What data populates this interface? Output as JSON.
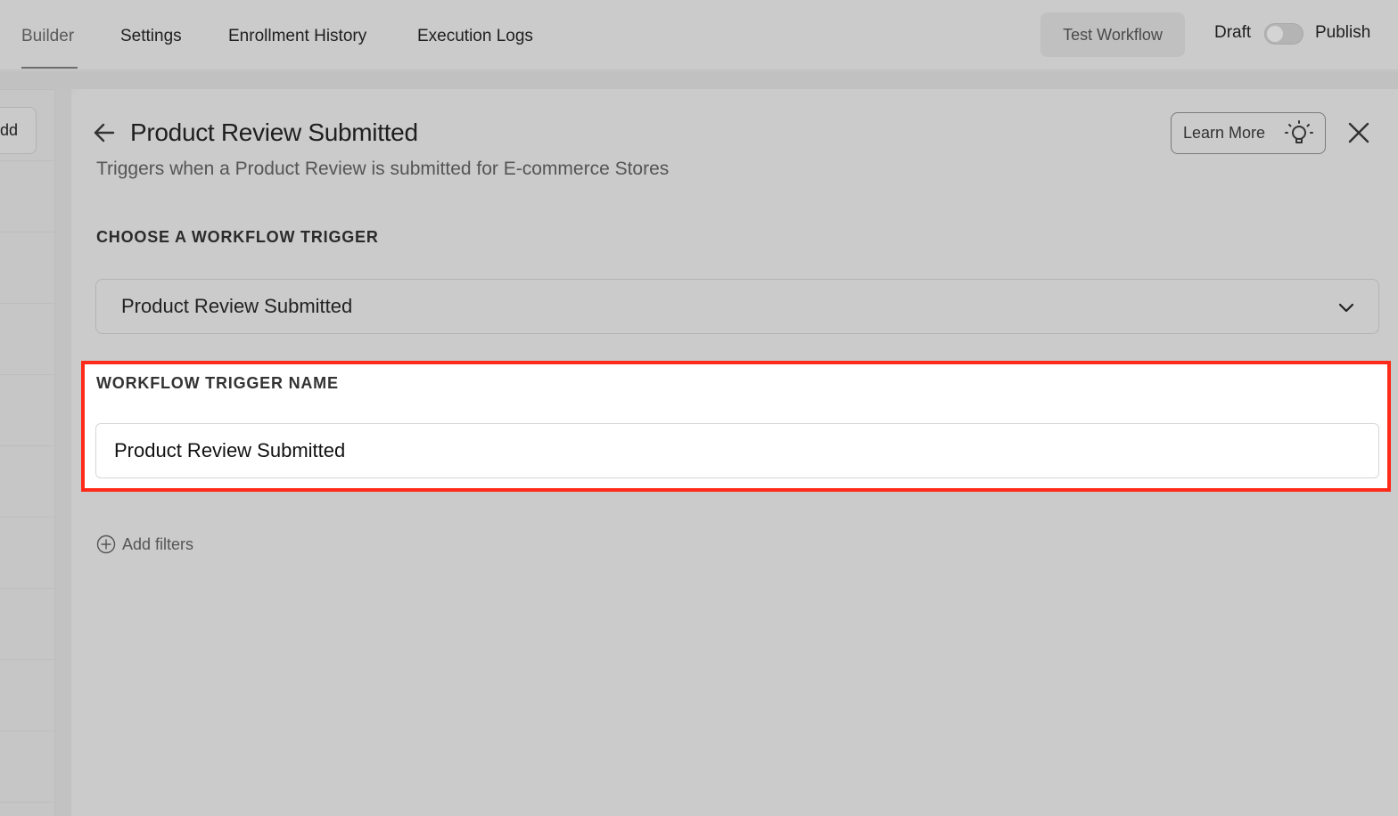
{
  "nav": {
    "tabs": [
      {
        "label": "Builder",
        "active": true
      },
      {
        "label": "Settings",
        "active": false
      },
      {
        "label": "Enrollment History",
        "active": false
      },
      {
        "label": "Execution Logs",
        "active": false
      }
    ],
    "test_workflow_label": "Test Workflow",
    "draft_label": "Draft",
    "publish_label": "Publish",
    "publish_toggle_on": false
  },
  "sidebar": {
    "add_button_label": "Add"
  },
  "panel": {
    "title": "Product Review Submitted",
    "subtitle": "Triggers when a Product Review is submitted for E-commerce Stores",
    "learn_more_label": "Learn More",
    "trigger_section_label": "CHOOSE A WORKFLOW TRIGGER",
    "selected_trigger": "Product Review Submitted",
    "name_section_label": "WORKFLOW TRIGGER NAME",
    "trigger_name_value": "Product Review Submitted",
    "add_filters_label": "Add filters"
  },
  "colors": {
    "highlight_border": "#ff2a1a",
    "background": "#cbcbcb"
  },
  "icons": [
    "back-arrow-icon",
    "lightbulb-icon",
    "close-icon",
    "chevron-down-icon",
    "plus-circle-icon"
  ]
}
